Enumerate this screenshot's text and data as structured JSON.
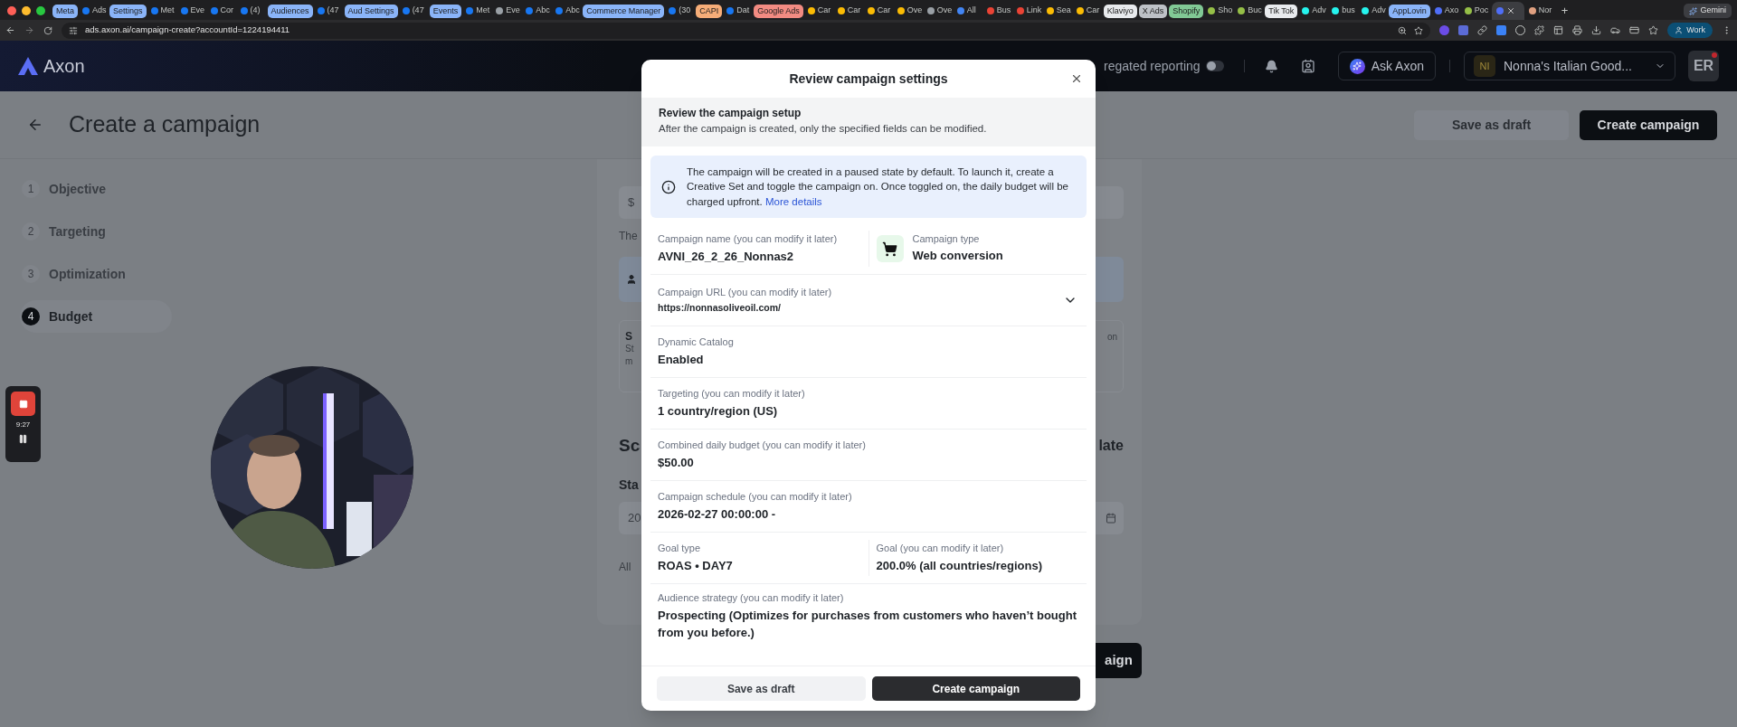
{
  "browser": {
    "tabs": [
      {
        "kind": "group",
        "label": "Meta",
        "color": "#8ab4f8"
      },
      {
        "kind": "tab",
        "label": "Ads",
        "color": "#1877f2",
        "selected": false
      },
      {
        "kind": "group",
        "label": "Settings",
        "color": "#8ab4f8"
      },
      {
        "kind": "tab",
        "label": "Met",
        "color": "#1877f2",
        "selected": false
      },
      {
        "kind": "tab",
        "label": "Eve",
        "color": "#1877f2",
        "selected": false
      },
      {
        "kind": "tab",
        "label": "Cor",
        "color": "#1877f2",
        "selected": false
      },
      {
        "kind": "tab",
        "label": "(4)",
        "color": "#1877f2",
        "selected": false
      },
      {
        "kind": "group",
        "label": "Audiences",
        "color": "#8ab4f8"
      },
      {
        "kind": "tab",
        "label": "(47",
        "color": "#1877f2",
        "selected": false
      },
      {
        "kind": "group",
        "label": "Aud Settings",
        "color": "#8ab4f8"
      },
      {
        "kind": "tab",
        "label": "(47",
        "color": "#1877f2",
        "selected": false
      },
      {
        "kind": "group",
        "label": "Events",
        "color": "#8ab4f8"
      },
      {
        "kind": "tab",
        "label": "Met",
        "color": "#1877f2",
        "selected": false
      },
      {
        "kind": "tab",
        "label": "Eve",
        "color": "#9aa0a6",
        "selected": false
      },
      {
        "kind": "tab",
        "label": "Abc",
        "color": "#1877f2",
        "selected": false
      },
      {
        "kind": "tab",
        "label": "Abc",
        "color": "#1877f2",
        "selected": false
      },
      {
        "kind": "group",
        "label": "Commerce Manager",
        "color": "#8ab4f8"
      },
      {
        "kind": "tab",
        "label": "(30",
        "color": "#1877f2",
        "selected": false
      },
      {
        "kind": "group",
        "label": "CAPI",
        "color": "#f6ad78"
      },
      {
        "kind": "tab",
        "label": "Dat",
        "color": "#1877f2",
        "selected": false
      },
      {
        "kind": "group",
        "label": "Google Ads",
        "color": "#f28b82"
      },
      {
        "kind": "tab",
        "label": "Car",
        "color": "#fbbc04",
        "selected": false
      },
      {
        "kind": "tab",
        "label": "Car",
        "color": "#fbbc04",
        "selected": false
      },
      {
        "kind": "tab",
        "label": "Car",
        "color": "#fbbc04",
        "selected": false
      },
      {
        "kind": "tab",
        "label": "Ove",
        "color": "#fbbc04",
        "selected": false
      },
      {
        "kind": "tab",
        "label": "Ove",
        "color": "#9aa0a6",
        "selected": false
      },
      {
        "kind": "tab",
        "label": "All",
        "color": "#4285f4",
        "selected": false
      },
      {
        "kind": "tab",
        "label": "Bus",
        "color": "#ea4335",
        "selected": false
      },
      {
        "kind": "tab",
        "label": "Link",
        "color": "#ea4335",
        "selected": false
      },
      {
        "kind": "tab",
        "label": "Sea",
        "color": "#fbbc04",
        "selected": false
      },
      {
        "kind": "tab",
        "label": "Car",
        "color": "#fbbc04",
        "selected": false
      },
      {
        "kind": "group",
        "label": "Klaviyo",
        "color": "#e8eaed"
      },
      {
        "kind": "group",
        "label": "X Ads",
        "color": "#bdc1c6"
      },
      {
        "kind": "group",
        "label": "Shopify",
        "color": "#81c995"
      },
      {
        "kind": "tab",
        "label": "Sho",
        "color": "#95bf47",
        "selected": false
      },
      {
        "kind": "tab",
        "label": "Buc",
        "color": "#95bf47",
        "selected": false
      },
      {
        "kind": "group",
        "label": "Tik Tok",
        "color": "#e8eaed"
      },
      {
        "kind": "tab",
        "label": "Adv",
        "color": "#25f4ee",
        "selected": false
      },
      {
        "kind": "tab",
        "label": "bus",
        "color": "#25f4ee",
        "selected": false
      },
      {
        "kind": "tab",
        "label": "Adv",
        "color": "#25f4ee",
        "selected": false
      },
      {
        "kind": "group",
        "label": "AppLovin",
        "color": "#8ab4f8"
      },
      {
        "kind": "tab",
        "label": "Axo",
        "color": "#4f6ef7",
        "selected": false
      },
      {
        "kind": "tab",
        "label": "Poc",
        "color": "#95bf47",
        "selected": false
      },
      {
        "kind": "tab",
        "color": "#4f6ef7",
        "selected": true
      },
      {
        "kind": "tab",
        "label": "Nor",
        "color": "#e0a080",
        "selected": false
      }
    ],
    "new_tab": "+",
    "gemini": "Gemini",
    "url": "ads.axon.ai/campaign-create?accountId=1224194411",
    "profile": "Work"
  },
  "header": {
    "logo": "Axon",
    "reporting_label": "regated reporting",
    "reporting_on": false,
    "ask": "Ask Axon",
    "account_initials": "NI",
    "account_name": "Nonna's Italian Good...",
    "avatar": "ER"
  },
  "page": {
    "title": "Create a campaign",
    "save_draft": "Save as draft",
    "create": "Create campaign",
    "steps": [
      {
        "number": "1",
        "label": "Objective",
        "selected": false
      },
      {
        "number": "2",
        "label": "Targeting",
        "selected": false
      },
      {
        "number": "3",
        "label": "Optimization",
        "selected": false
      },
      {
        "number": "4",
        "label": "Budget",
        "selected": true
      }
    ]
  },
  "background": {
    "amount_symbol": "$",
    "amount_hint": "The",
    "card_title": "S",
    "card_line_1": "St",
    "card_line_2": "m",
    "card_right": "on",
    "schedule_title": "Sc",
    "schedule_right": "late",
    "start_label": "Sta",
    "start_value": "20",
    "footnote": "All",
    "create_fragment": "aign"
  },
  "recorder": {
    "time": "9:27"
  },
  "modal": {
    "title": "Review campaign settings",
    "setup_title": "Review the campaign setup",
    "setup_text": "After the campaign is created, only the specified fields can be modified.",
    "notice": "The campaign will be created in a paused state by default. To launch it, create a Creative Set and toggle the campaign on. Once toggled on, the daily budget will be charged upfront.",
    "notice_link": "More details",
    "rows": [
      {
        "fields": [
          {
            "kind": "text",
            "label": "Campaign name (you can modify it later)",
            "value": "AVNI_26_2_26_Nonnas2"
          },
          {
            "kind": "cart",
            "label": "Campaign type",
            "value": "Web conversion"
          }
        ]
      },
      {
        "expanded": false,
        "fields": [
          {
            "kind": "url",
            "label": "Campaign URL (you can modify it later)",
            "value": "https://nonnasoliveoil.com/"
          }
        ]
      },
      {
        "fields": [
          {
            "kind": "text",
            "label": "Dynamic Catalog",
            "value": "Enabled"
          }
        ]
      },
      {
        "fields": [
          {
            "kind": "text",
            "label": "Targeting (you can modify it later)",
            "value": "1 country/region (US)"
          }
        ]
      },
      {
        "fields": [
          {
            "kind": "text",
            "label": "Combined daily budget (you can modify it later)",
            "value": "$50.00"
          }
        ]
      },
      {
        "fields": [
          {
            "kind": "text",
            "label": "Campaign schedule (you can modify it later)",
            "value": "2026-02-27 00:00:00 -"
          }
        ]
      },
      {
        "fields": [
          {
            "kind": "text",
            "label": "Goal type",
            "value": "ROAS • DAY7"
          },
          {
            "kind": "text",
            "label": "Goal (you can modify it later)",
            "value": "200.0% (all countries/regions)"
          }
        ]
      },
      {
        "fields": [
          {
            "kind": "text",
            "label": "Audience strategy (you can modify it later)",
            "value": "Prospecting (Optimizes for purchases from customers who haven’t bought from you before.)"
          }
        ]
      }
    ],
    "secondary_button": "Save as draft",
    "primary_button": "Create campaign"
  }
}
